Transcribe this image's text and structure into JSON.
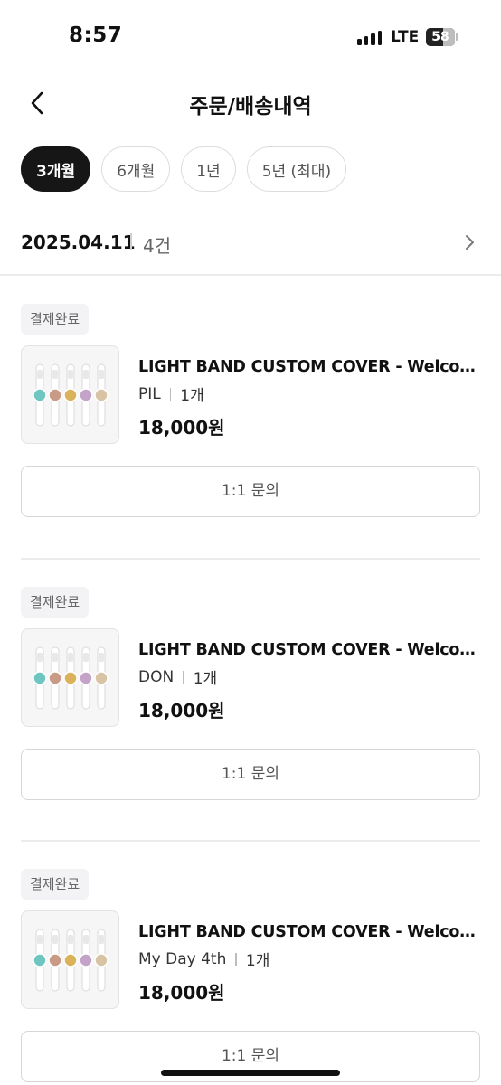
{
  "status_bar": {
    "time": "8:57",
    "network": "LTE",
    "battery_percent": "58",
    "signal_icon": "signal-bars-icon",
    "battery_icon": "battery-icon"
  },
  "header": {
    "title": "주문/배송내역",
    "back_icon": "chevron-left-icon"
  },
  "filters": {
    "chips": [
      "3개월",
      "6개월",
      "1년",
      "5년 (최대)"
    ],
    "selected": "3개월"
  },
  "order_group": {
    "date": "2025.04.11",
    "count": "4건",
    "chevron_icon": "chevron-right-icon"
  },
  "orders": [
    {
      "status": "결제완료",
      "product_name": "LIGHT BAND CUSTOM COVER - Welcome",
      "option": "PIL",
      "quantity": "1개",
      "price": "18,000원",
      "inquiry_label": "1:1 문의"
    },
    {
      "status": "결제완료",
      "product_name": "LIGHT BAND CUSTOM COVER - Welcome",
      "option": "DON",
      "quantity": "1개",
      "price": "18,000원",
      "inquiry_label": "1:1 문의"
    },
    {
      "status": "결제완료",
      "product_name": "LIGHT BAND CUSTOM COVER - Welcome",
      "option": "My Day 4th",
      "quantity": "1개",
      "price": "18,000원",
      "inquiry_label": "1:1 문의"
    }
  ],
  "colors": {
    "chip_active_bg": "#161616",
    "badge_bg": "#f3f3f5",
    "divider": "#ececec",
    "band_dots": [
      "#6fc6c0",
      "#c99a86",
      "#d9b25a",
      "#c4a3c9",
      "#d8c4a4"
    ]
  }
}
